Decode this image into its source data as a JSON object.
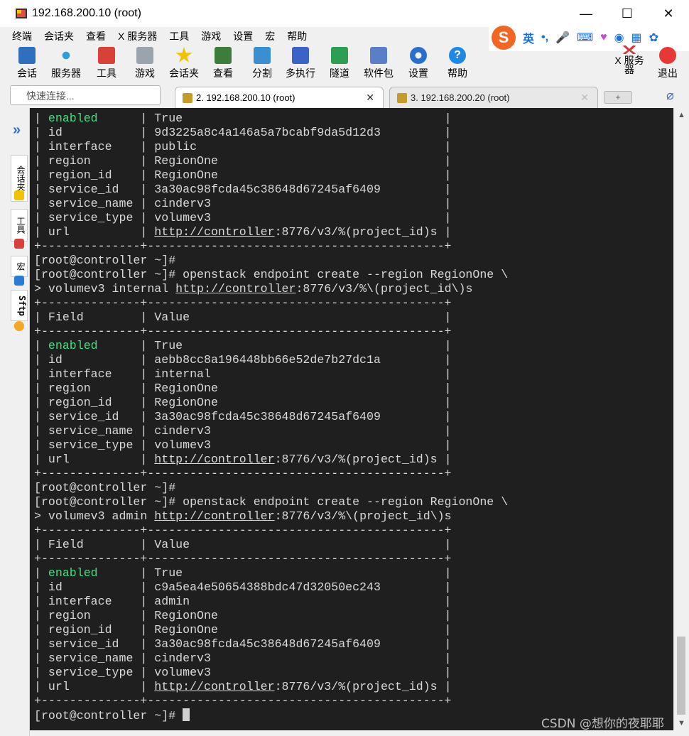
{
  "window": {
    "title": "192.168.200.10 (root)",
    "min": "—",
    "max": "☐",
    "close": "✕"
  },
  "menu": [
    "终端",
    "会话夹",
    "查看",
    "X 服务器",
    "工具",
    "游戏",
    "设置",
    "宏",
    "帮助"
  ],
  "ime": {
    "logo": "S",
    "lang": "英",
    "punct": "•,"
  },
  "toolbar": {
    "items": [
      "会话",
      "服务器",
      "工具",
      "游戏",
      "会话夹",
      "查看",
      "分割",
      "多执行",
      "隧道",
      "软件包",
      "设置",
      "帮助"
    ],
    "xserver": "X 服务器",
    "exit": "退出"
  },
  "quick_connect": {
    "placeholder": "快速连接..."
  },
  "tabs": [
    {
      "label": "2. 192.168.200.10 (root)",
      "close": "✕"
    },
    {
      "label": "3. 192.168.200.20 (root)",
      "close": "✕"
    }
  ],
  "sidebar": {
    "tabs": [
      "会话夹",
      "工具",
      "宏",
      "Sftp"
    ]
  },
  "terminal": {
    "lines": [
      [
        {
          "t": "| "
        },
        {
          "t": "enabled",
          "c": "green"
        },
        {
          "t": "      | True                                     |"
        }
      ],
      [
        {
          "t": "| id           | 9d3225a8c4a146a5a7bcabf9da5d12d3         |"
        }
      ],
      [
        {
          "t": "| interface    | public                                   |"
        }
      ],
      [
        {
          "t": "| region       | RegionOne                                |"
        }
      ],
      [
        {
          "t": "| region_id    | RegionOne                                |"
        }
      ],
      [
        {
          "t": "| service_id   | 3a30ac98fcda45c38648d67245af6409         |"
        }
      ],
      [
        {
          "t": "| service_name | cinderv3                                 |"
        }
      ],
      [
        {
          "t": "| service_type | volumev3                                 |"
        }
      ],
      [
        {
          "t": "| url          | "
        },
        {
          "t": "http://controller",
          "c": "ul"
        },
        {
          "t": ":8776/v3/%(project_id)s |"
        }
      ],
      [
        {
          "t": "+--------------+------------------------------------------+"
        }
      ],
      [
        {
          "t": "[root@controller ~]#"
        }
      ],
      [
        {
          "t": "[root@controller ~]# openstack endpoint create --region RegionOne \\"
        }
      ],
      [
        {
          "t": "> volumev3 internal "
        },
        {
          "t": "http://controller",
          "c": "ul"
        },
        {
          "t": ":8776/v3/%\\(project_id\\)s"
        }
      ],
      [
        {
          "t": "+--------------+------------------------------------------+"
        }
      ],
      [
        {
          "t": "| Field        | Value                                    |"
        }
      ],
      [
        {
          "t": "+--------------+------------------------------------------+"
        }
      ],
      [
        {
          "t": "| "
        },
        {
          "t": "enabled",
          "c": "green"
        },
        {
          "t": "      | True                                     |"
        }
      ],
      [
        {
          "t": "| id           | aebb8cc8a196448bb66e52de7b27dc1a         |"
        }
      ],
      [
        {
          "t": "| interface    | internal                                 |"
        }
      ],
      [
        {
          "t": "| region       | RegionOne                                |"
        }
      ],
      [
        {
          "t": "| region_id    | RegionOne                                |"
        }
      ],
      [
        {
          "t": "| service_id   | 3a30ac98fcda45c38648d67245af6409         |"
        }
      ],
      [
        {
          "t": "| service_name | cinderv3                                 |"
        }
      ],
      [
        {
          "t": "| service_type | volumev3                                 |"
        }
      ],
      [
        {
          "t": "| url          | "
        },
        {
          "t": "http://controller",
          "c": "ul"
        },
        {
          "t": ":8776/v3/%(project_id)s |"
        }
      ],
      [
        {
          "t": "+--------------+------------------------------------------+"
        }
      ],
      [
        {
          "t": "[root@controller ~]#"
        }
      ],
      [
        {
          "t": "[root@controller ~]# openstack endpoint create --region RegionOne \\"
        }
      ],
      [
        {
          "t": "> volumev3 admin "
        },
        {
          "t": "http://controller",
          "c": "ul"
        },
        {
          "t": ":8776/v3/%\\(project_id\\)s"
        }
      ],
      [
        {
          "t": "+--------------+------------------------------------------+"
        }
      ],
      [
        {
          "t": "| Field        | Value                                    |"
        }
      ],
      [
        {
          "t": "+--------------+------------------------------------------+"
        }
      ],
      [
        {
          "t": "| "
        },
        {
          "t": "enabled",
          "c": "green"
        },
        {
          "t": "      | True                                     |"
        }
      ],
      [
        {
          "t": "| id           | c9a5ea4e50654388bdc47d32050ec243         |"
        }
      ],
      [
        {
          "t": "| interface    | admin                                    |"
        }
      ],
      [
        {
          "t": "| region       | RegionOne                                |"
        }
      ],
      [
        {
          "t": "| region_id    | RegionOne                                |"
        }
      ],
      [
        {
          "t": "| service_id   | 3a30ac98fcda45c38648d67245af6409         |"
        }
      ],
      [
        {
          "t": "| service_name | cinderv3                                 |"
        }
      ],
      [
        {
          "t": "| service_type | volumev3                                 |"
        }
      ],
      [
        {
          "t": "| url          | "
        },
        {
          "t": "http://controller",
          "c": "ul"
        },
        {
          "t": ":8776/v3/%(project_id)s |"
        }
      ],
      [
        {
          "t": "+--------------+------------------------------------------+"
        }
      ],
      [
        {
          "t": "[root@controller ~]# "
        },
        {
          "t": "",
          "c": "cursor"
        }
      ]
    ]
  },
  "scrollbar": {
    "up": "▲",
    "down": "▼"
  },
  "watermark": "CSDN @想你的夜耶耶"
}
